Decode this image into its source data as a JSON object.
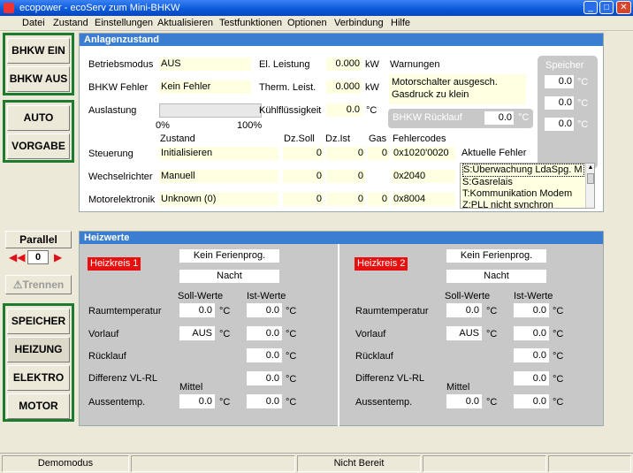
{
  "window": {
    "title": "ecopower - ecoServ zum Mini-BHKW"
  },
  "menu": [
    "Datei",
    "Zustand",
    "Einstellungen",
    "Aktualisieren",
    "Testfunktionen",
    "Optionen",
    "Verbindung",
    "Hilfe"
  ],
  "left": {
    "bhkw_ein": "BHKW EIN",
    "bhkw_aus": "BHKW AUS",
    "auto": "AUTO",
    "vorgabe": "VORGABE",
    "parallel": "Parallel",
    "parallel_value": "0",
    "trennen": "Trennen",
    "speicher": "SPEICHER",
    "heizung": "HEIZUNG",
    "elektro": "ELEKTRO",
    "motor": "MOTOR"
  },
  "anlage": {
    "header": "Anlagenzustand",
    "betriebsmodus_label": "Betriebsmodus",
    "betriebsmodus": "AUS",
    "fehler_label": "BHKW Fehler",
    "fehler": "Kein Fehler",
    "auslastung_label": "Auslastung",
    "auslastung_min": "0%",
    "auslastung_max": "100%",
    "auslastung_value": 0,
    "el_label": "El. Leistung",
    "el_value": "0.000",
    "el_unit": "kW",
    "th_label": "Therm. Leist.",
    "th_value": "0.000",
    "th_unit": "kW",
    "kuehl_label": "Kühlflüssigkeit",
    "kuehl_value": "0.0",
    "kuehl_unit": "°C",
    "warnungen_label": "Warnungen",
    "warnungen": "Motorschalter ausgesch. Gasdruck zu klein",
    "ruecklauf_label": "BHKW Rücklauf",
    "ruecklauf_value": "0.0",
    "ruecklauf_unit": "°C",
    "speicher_label": "Speicher",
    "speicher_values": [
      "0.0",
      "0.0",
      "0.0"
    ],
    "speicher_unit": "°C",
    "col_zustand": "Zustand",
    "col_dzsoll": "Dz.Soll",
    "col_dzist": "Dz.Ist",
    "col_gas": "Gas",
    "col_fehlercodes": "Fehlercodes",
    "aktuelle_fehler_label": "Aktuelle Fehler",
    "rows": [
      {
        "label": "Steuerung",
        "zustand": "Initialisieren",
        "dzsoll": "0",
        "dzist": "0",
        "gas": "0",
        "code": "0x1020'0020"
      },
      {
        "label": "Wechselrichter",
        "zustand": "Manuell",
        "dzsoll": "0",
        "dzist": "0",
        "gas": "",
        "code": "0x2040"
      },
      {
        "label": "Motorelektronik",
        "zustand": "Unknown (0)",
        "dzsoll": "0",
        "dzist": "0",
        "gas": "0",
        "code": "0x8004"
      }
    ],
    "fehler_list": [
      "S:Überwachung LdaSpg. M",
      "S:Gasrelais",
      "T:Kommunikation Modem",
      "Z:PLL nicht synchron"
    ]
  },
  "heiz": {
    "header": "Heizwerte",
    "kreise": [
      {
        "name": "Heizkreis 1",
        "ferien": "Kein Ferienprog.",
        "modus": "Nacht",
        "soll_label": "Soll-Werte",
        "ist_label": "Ist-Werte",
        "mittel_label": "Mittel",
        "raum_label": "Raumtemperatur",
        "raum_soll": "0.0",
        "raum_ist": "0.0",
        "vorlauf_label": "Vorlauf",
        "vorlauf_soll": "AUS",
        "vorlauf_ist": "0.0",
        "ruecklauf_label": "Rücklauf",
        "ruecklauf_ist": "0.0",
        "diff_label": "Differenz VL-RL",
        "diff_ist": "0.0",
        "aussen_label": "Aussentemp.",
        "aussen_mittel": "0.0",
        "aussen_ist": "0.0",
        "unit": "°C"
      },
      {
        "name": "Heizkreis 2",
        "ferien": "Kein Ferienprog.",
        "modus": "Nacht",
        "soll_label": "Soll-Werte",
        "ist_label": "Ist-Werte",
        "mittel_label": "Mittel",
        "raum_label": "Raumtemperatur",
        "raum_soll": "0.0",
        "raum_ist": "0.0",
        "vorlauf_label": "Vorlauf",
        "vorlauf_soll": "AUS",
        "vorlauf_ist": "0.0",
        "ruecklauf_label": "Rücklauf",
        "ruecklauf_ist": "0.0",
        "diff_label": "Differenz VL-RL",
        "diff_ist": "0.0",
        "aussen_label": "Aussentemp.",
        "aussen_mittel": "0.0",
        "aussen_ist": "0.0",
        "unit": "°C"
      }
    ]
  },
  "status": {
    "mode": "Demomodus",
    "state": "Nicht Bereit"
  }
}
